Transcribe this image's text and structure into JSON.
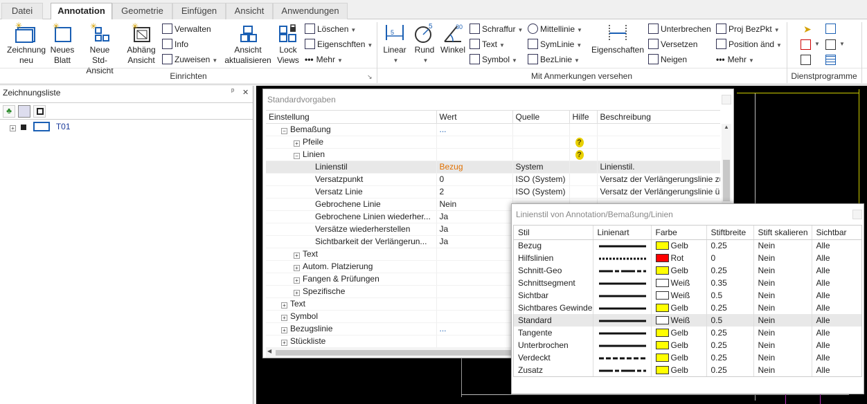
{
  "tabs": [
    {
      "label": "Datei"
    },
    {
      "label": "Annotation"
    },
    {
      "label": "Geometrie"
    },
    {
      "label": "Einfügen"
    },
    {
      "label": "Ansicht"
    },
    {
      "label": "Anwendungen"
    }
  ],
  "ribbon": {
    "groups": {
      "einrichten": "Einrichten",
      "mit_anmerkungen": "Mit Anmerkungen versehen",
      "dienstprogramme": "Dienstprogramme"
    },
    "zeichnung_neu": "Zeichnung neu",
    "neues_blatt": "Neues Blatt",
    "neue_std_ansicht": "Neue Std-Ansicht",
    "abhaeng_ansicht": "Abhäng Ansicht",
    "verwalten": "Verwalten",
    "info": "Info",
    "zuweisen": "Zuweisen",
    "ansicht_aktualisieren": "Ansicht aktualisieren",
    "lock_views": "Lock Views",
    "loeschen": "Löschen",
    "eigenschaften_sm": "Eigenschften",
    "mehr1": "Mehr",
    "linear": "Linear",
    "rund": "Rund",
    "winkel": "Winkel",
    "rund_badge": "5",
    "winkel_badge": "30",
    "schraffur": "Schraffur",
    "text": "Text",
    "symbol": "Symbol",
    "mittellinie": "Mittellinie",
    "symlinie": "SymLinie",
    "bezlinie": "BezLinie",
    "eigenschaften": "Eigenschaften",
    "unterbrechen": "Unterbrechen",
    "versetzen": "Versetzen",
    "neigen": "Neigen",
    "proj_bezpkt": "Proj BezPkt",
    "position_and": "Position änd",
    "mehr2": "Mehr"
  },
  "drawing_list": {
    "title": "Zeichnungsliste",
    "item": "T01",
    "pin": "ᵖ",
    "close": "✕"
  },
  "standardvorgaben": {
    "title": "Standardvorgaben",
    "columns": [
      "Einstellung",
      "Wert",
      "Quelle",
      "Hilfe",
      "Beschreibung"
    ],
    "rows": [
      {
        "indent": 1,
        "tw": "−",
        "label": "Bemaßung",
        "wert": "...",
        "quelle": "",
        "hilfe": false,
        "desc": ""
      },
      {
        "indent": 2,
        "tw": "+",
        "label": "Pfeile",
        "wert": "",
        "quelle": "",
        "hilfe": true,
        "desc": ""
      },
      {
        "indent": 2,
        "tw": "−",
        "label": "Linien",
        "wert": "",
        "quelle": "",
        "hilfe": true,
        "desc": ""
      },
      {
        "indent": 3,
        "tw": "",
        "label": "Linienstil",
        "wert": "Bezug",
        "quelle": "System",
        "hilfe": false,
        "desc": "Linienstil.",
        "selected": true
      },
      {
        "indent": 3,
        "tw": "",
        "label": "Versatzpunkt",
        "wert": "0",
        "quelle": "ISO (System)",
        "hilfe": false,
        "desc": "Versatz der Verlängerungslinie zu"
      },
      {
        "indent": 3,
        "tw": "",
        "label": "Versatz Linie",
        "wert": "2",
        "quelle": "ISO (System)",
        "hilfe": false,
        "desc": "Versatz der Verlängerungslinie üb"
      },
      {
        "indent": 3,
        "tw": "",
        "label": "Gebrochene Linie",
        "wert": "Nein",
        "quelle": "",
        "hilfe": false,
        "desc": ""
      },
      {
        "indent": 3,
        "tw": "",
        "label": "Gebrochene Linien wiederher...",
        "wert": "Ja",
        "quelle": "",
        "hilfe": false,
        "desc": ""
      },
      {
        "indent": 3,
        "tw": "",
        "label": "Versätze wiederherstellen",
        "wert": "Ja",
        "quelle": "",
        "hilfe": false,
        "desc": ""
      },
      {
        "indent": 3,
        "tw": "",
        "label": "Sichtbarkeit der Verlängerun...",
        "wert": "Ja",
        "quelle": "",
        "hilfe": false,
        "desc": ""
      },
      {
        "indent": 2,
        "tw": "+",
        "label": "Text",
        "wert": "",
        "quelle": "",
        "hilfe": false,
        "desc": ""
      },
      {
        "indent": 2,
        "tw": "+",
        "label": "Autom. Platzierung",
        "wert": "",
        "quelle": "",
        "hilfe": false,
        "desc": ""
      },
      {
        "indent": 2,
        "tw": "+",
        "label": "Fangen & Prüfungen",
        "wert": "",
        "quelle": "",
        "hilfe": false,
        "desc": ""
      },
      {
        "indent": 2,
        "tw": "+",
        "label": "Spezifische",
        "wert": "",
        "quelle": "",
        "hilfe": false,
        "desc": ""
      },
      {
        "indent": 1,
        "tw": "+",
        "label": "Text",
        "wert": "",
        "quelle": "",
        "hilfe": false,
        "desc": ""
      },
      {
        "indent": 1,
        "tw": "+",
        "label": "Symbol",
        "wert": "",
        "quelle": "",
        "hilfe": false,
        "desc": ""
      },
      {
        "indent": 1,
        "tw": "+",
        "label": "Bezugslinie",
        "wert": "...",
        "quelle": "",
        "hilfe": false,
        "desc": ""
      },
      {
        "indent": 1,
        "tw": "+",
        "label": "Stückliste",
        "wert": "",
        "quelle": "",
        "hilfe": false,
        "desc": ""
      }
    ]
  },
  "linienstil": {
    "title": "Linienstil von Annotation/Bemaßung/Linien",
    "columns": [
      "Stil",
      "Linienart",
      "Farbe",
      "Stiftbreite",
      "Stift skalieren",
      "Sichtbar"
    ],
    "rows": [
      {
        "stil": "Bezug",
        "art": "solid",
        "farbe": "Gelb",
        "color": "#ffff00",
        "breite": "0.25",
        "skal": "Nein",
        "sicht": "Alle"
      },
      {
        "stil": "Hilfslinien",
        "art": "dotted",
        "farbe": "Rot",
        "color": "#ff0000",
        "breite": "0",
        "skal": "Nein",
        "sicht": "Alle"
      },
      {
        "stil": "Schnitt-Geo",
        "art": "dashdot",
        "farbe": "Gelb",
        "color": "#ffff00",
        "breite": "0.25",
        "skal": "Nein",
        "sicht": "Alle"
      },
      {
        "stil": "Schnittsegment",
        "art": "solid",
        "farbe": "Weiß",
        "color": "#ffffff",
        "breite": "0.35",
        "skal": "Nein",
        "sicht": "Alle"
      },
      {
        "stil": "Sichtbar",
        "art": "solid",
        "farbe": "Weiß",
        "color": "#ffffff",
        "breite": "0.5",
        "skal": "Nein",
        "sicht": "Alle"
      },
      {
        "stil": "Sichtbares Gewinde",
        "art": "solid",
        "farbe": "Gelb",
        "color": "#ffff00",
        "breite": "0.25",
        "skal": "Nein",
        "sicht": "Alle"
      },
      {
        "stil": "Standard",
        "art": "solid",
        "farbe": "Weiß",
        "color": "#ffffff",
        "breite": "0.5",
        "skal": "Nein",
        "sicht": "Alle",
        "selected": true
      },
      {
        "stil": "Tangente",
        "art": "solid",
        "farbe": "Gelb",
        "color": "#ffff00",
        "breite": "0.25",
        "skal": "Nein",
        "sicht": "Alle"
      },
      {
        "stil": "Unterbrochen",
        "art": "solid",
        "farbe": "Gelb",
        "color": "#ffff00",
        "breite": "0.25",
        "skal": "Nein",
        "sicht": "Alle"
      },
      {
        "stil": "Verdeckt",
        "art": "dashed",
        "farbe": "Gelb",
        "color": "#ffff00",
        "breite": "0.25",
        "skal": "Nein",
        "sicht": "Alle"
      },
      {
        "stil": "Zusatz",
        "art": "dashdot",
        "farbe": "Gelb",
        "color": "#ffff00",
        "breite": "0.25",
        "skal": "Nein",
        "sicht": "Alle"
      }
    ]
  },
  "colors": {
    "accent": "#1a5fb4",
    "selected_value": "#e07000",
    "canvas": "#000000",
    "help": "#e8d000"
  }
}
